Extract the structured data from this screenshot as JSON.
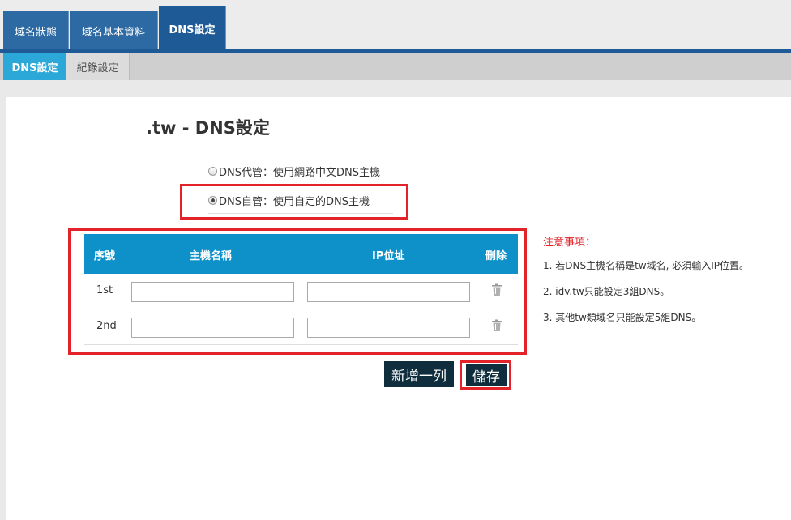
{
  "top_tabs": [
    {
      "label": "域名狀態"
    },
    {
      "label": "域名基本資料"
    },
    {
      "label": "DNS設定"
    }
  ],
  "sub_tabs": [
    {
      "label": "DNS設定"
    },
    {
      "label": "紀錄設定"
    }
  ],
  "page": {
    "title": ".tw - DNS設定"
  },
  "dns_mode": {
    "option_hosted": "DNS代管：使用網路中文DNS主機",
    "option_self": "DNS自管：使用自定的DNS主機",
    "selected": "self"
  },
  "table": {
    "headers": {
      "seq": "序號",
      "hostname": "主機名稱",
      "ip": "IP位址",
      "delete": "刪除"
    },
    "rows": [
      {
        "seq": "1st",
        "hostname": "",
        "ip": ""
      },
      {
        "seq": "2nd",
        "hostname": "",
        "ip": ""
      }
    ]
  },
  "actions": {
    "add_row": "新增一列",
    "save": "儲存"
  },
  "notes": {
    "title": "注意事項：",
    "items": [
      "1. 若DNS主機名稱是tw域名, 必須輸入IP位置。",
      "2. idv.tw只能設定3組DNS。",
      "3. 其他tw類域名只能設定5組DNS。"
    ]
  },
  "colors": {
    "tab_blue": "#2d6aa3",
    "sub_tab_active": "#2ba8d8",
    "table_header": "#0e91c8",
    "highlight_red": "#e2232a",
    "button_dark": "#0f2d3c"
  }
}
